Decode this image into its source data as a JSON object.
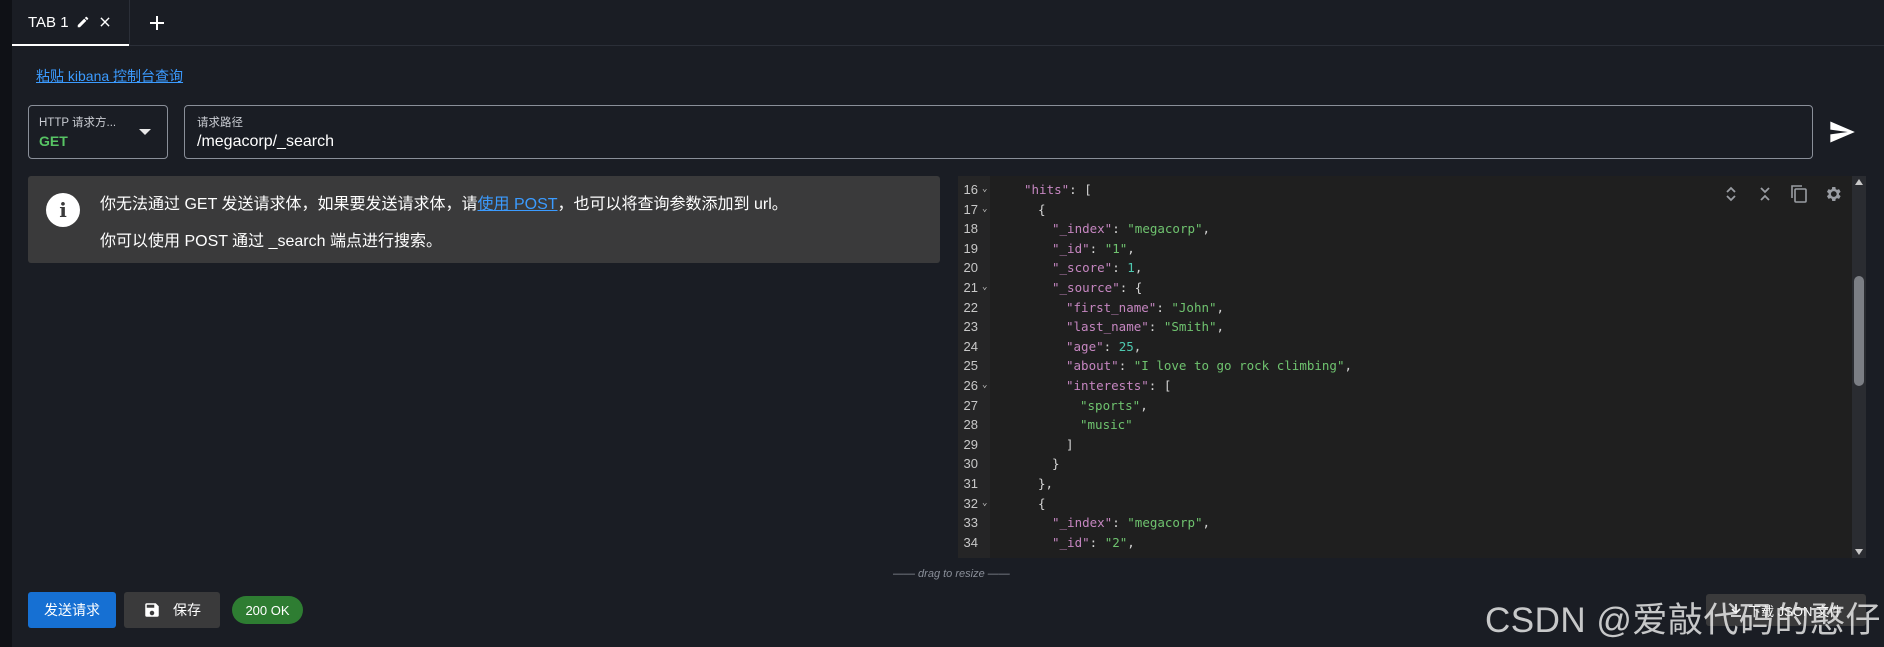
{
  "tabs": [
    {
      "label": "TAB 1"
    }
  ],
  "paste_link": "粘贴 kibana 控制台查询",
  "request": {
    "method_label": "HTTP 请求方...",
    "method_value": "GET",
    "path_label": "请求路径",
    "path_value": "/megacorp/_search"
  },
  "alert": {
    "line1_pre": "你无法通过 GET 发送请求体，如果要发送请求体，请",
    "line1_link": "使用 POST",
    "line1_post": "，也可以将查询参数添加到 url。",
    "line2": "你可以使用 POST 通过 _search 端点进行搜索。"
  },
  "editor": {
    "lines": [
      {
        "n": "16",
        "fold": true
      },
      {
        "n": "17",
        "fold": true
      },
      {
        "n": "18",
        "fold": false
      },
      {
        "n": "19",
        "fold": false
      },
      {
        "n": "20",
        "fold": false
      },
      {
        "n": "21",
        "fold": true
      },
      {
        "n": "22",
        "fold": false
      },
      {
        "n": "23",
        "fold": false
      },
      {
        "n": "24",
        "fold": false
      },
      {
        "n": "25",
        "fold": false
      },
      {
        "n": "26",
        "fold": true
      },
      {
        "n": "27",
        "fold": false
      },
      {
        "n": "28",
        "fold": false
      },
      {
        "n": "29",
        "fold": false
      },
      {
        "n": "30",
        "fold": false
      },
      {
        "n": "31",
        "fold": false
      },
      {
        "n": "32",
        "fold": true
      },
      {
        "n": "33",
        "fold": false
      },
      {
        "n": "34",
        "fold": false
      }
    ],
    "tokens": {
      "hits": "\"hits\"",
      "_index": "\"_index\"",
      "megacorp": "\"megacorp\"",
      "_id": "\"_id\"",
      "id1": "\"1\"",
      "id2": "\"2\"",
      "_score": "\"_score\"",
      "score1": "1",
      "_source": "\"_source\"",
      "first_name": "\"first_name\"",
      "john": "\"John\"",
      "last_name": "\"last_name\"",
      "smith": "\"Smith\"",
      "age": "\"age\"",
      "age25": "25",
      "about": "\"about\"",
      "about_val": "\"I love to go rock climbing\"",
      "interests": "\"interests\"",
      "sports": "\"sports\"",
      "music": "\"music\""
    }
  },
  "drag_hint": "—— drag to resize ——",
  "footer": {
    "send_label": "发送请求",
    "save_label": "保存",
    "status": "200 OK",
    "download_label": "下载 JSON 文件"
  },
  "watermark": "CSDN @爱敲代码的憨仔",
  "colors": {
    "accent_blue": "#1670d3",
    "link_blue": "#3b9bff",
    "method_green": "#57c464",
    "status_green": "#2e7d32",
    "json_key": "#c586c0",
    "json_string": "#6fc36f",
    "json_number": "#4ec9b0"
  }
}
